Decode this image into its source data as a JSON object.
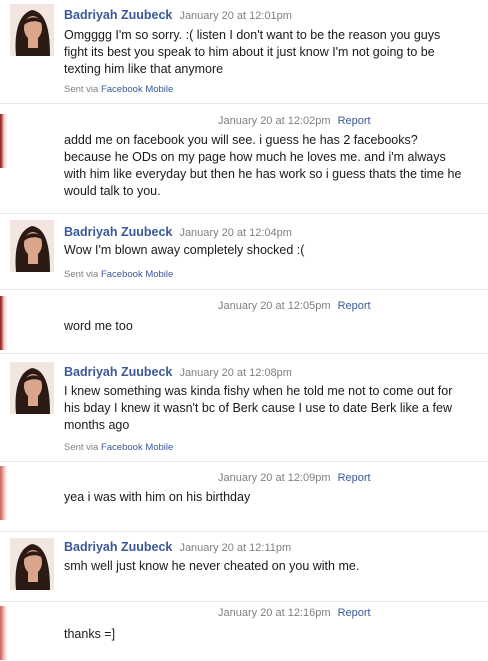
{
  "messages": [
    {
      "author": "Badriyah Zuubeck",
      "date": "January 20 at 12:01pm",
      "body": "Omgggg I'm so sorry. :( listen I don't want to be the reason you guys fight its best you speak to him about it just know I'm not going to be texting him like that anymore",
      "sent_prefix": "Sent via",
      "sent_link": "Facebook Mobile"
    },
    {
      "date": "January 20 at 12:02pm",
      "report": "Report",
      "body": "addd me on facebook you will see. i guess he has 2 facebooks? because he ODs on my page how much he loves me. and i'm always with him like everyday but then he has work so i guess thats the time he would talk to you."
    },
    {
      "author": "Badriyah Zuubeck",
      "date": "January 20 at 12:04pm",
      "body": "Wow I'm blown away completely shocked :(",
      "sent_prefix": "Sent via",
      "sent_link": "Facebook Mobile"
    },
    {
      "date": "January 20 at 12:05pm",
      "report": "Report",
      "body": "word me too"
    },
    {
      "author": "Badriyah Zuubeck",
      "date": "January 20 at 12:08pm",
      "body": "I knew something was kinda fishy when he told me not to come out for his bday I knew it wasn't bc of Berk cause I use to date Berk like a few months ago",
      "sent_prefix": "Sent via",
      "sent_link": "Facebook Mobile"
    },
    {
      "date": "January 20 at 12:09pm",
      "report": "Report",
      "body": "yea i was with him on his birthday"
    },
    {
      "author": "Badriyah Zuubeck",
      "date": "January 20 at 12:11pm",
      "body": "smh well just know he never cheated on you with me."
    },
    {
      "date": "January 20 at 12:16pm",
      "report": "Report",
      "body": "thanks =]"
    }
  ]
}
